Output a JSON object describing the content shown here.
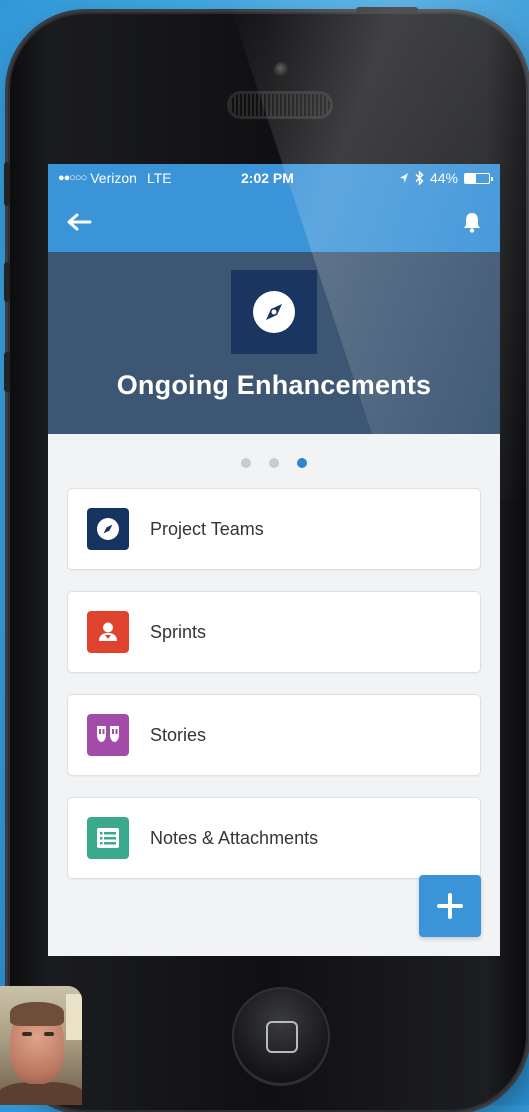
{
  "status_bar": {
    "signal_dots": "●●○○○",
    "carrier": "Verizon",
    "network": "LTE",
    "time": "2:02 PM",
    "battery_percent": "44%",
    "battery_level": 0.44
  },
  "nav": {
    "back_icon": "back-arrow-icon",
    "notifications_icon": "bell-icon"
  },
  "hero": {
    "icon": "compass-icon",
    "title": "Ongoing Enhancements"
  },
  "pager": {
    "count": 3,
    "active_index": 2
  },
  "cards": [
    {
      "label": "Project Teams",
      "icon": "compass-icon",
      "color": "#15345f"
    },
    {
      "label": "Sprints",
      "icon": "person-icon",
      "color": "#e0432d"
    },
    {
      "label": "Stories",
      "icon": "stories-icon",
      "color": "#a24ba9"
    },
    {
      "label": "Notes & Attachments",
      "icon": "notes-icon",
      "color": "#3aa98c"
    }
  ],
  "fab": {
    "icon": "plus-icon"
  },
  "colors": {
    "accent": "#3b93d8",
    "hero_bg": "#3c5673",
    "page_bg": "#f1f3f5"
  }
}
